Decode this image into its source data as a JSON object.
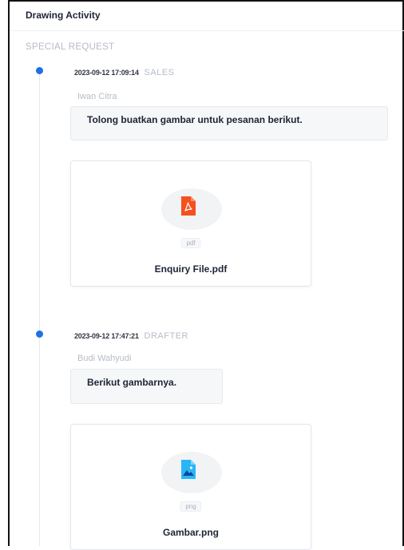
{
  "header": {
    "title": "Drawing Activity"
  },
  "section": {
    "title": "SPECIAL REQUEST"
  },
  "activities": [
    {
      "date": "2023-09-12 17:09:14",
      "role": "SALES",
      "author": "Iwan Citra",
      "message": "Tolong buatkan gambar untuk pesanan berikut.",
      "file": {
        "ext": "pdf",
        "name": "Enquiry File.pdf",
        "icon": "pdf-file-icon",
        "color": "#f4511e"
      }
    },
    {
      "date": "2023-09-12 17:47:21",
      "role": "DRAFTER",
      "author": "Budi Wahyudi",
      "message": "Berikut gambarnya.",
      "file": {
        "ext": "png",
        "name": "Gambar.png",
        "icon": "image-file-icon",
        "color": "#29b6f6"
      }
    }
  ],
  "colors": {
    "accent": "#1f6fe5",
    "muted": "#b6bcc6",
    "text": "#1d2433"
  }
}
